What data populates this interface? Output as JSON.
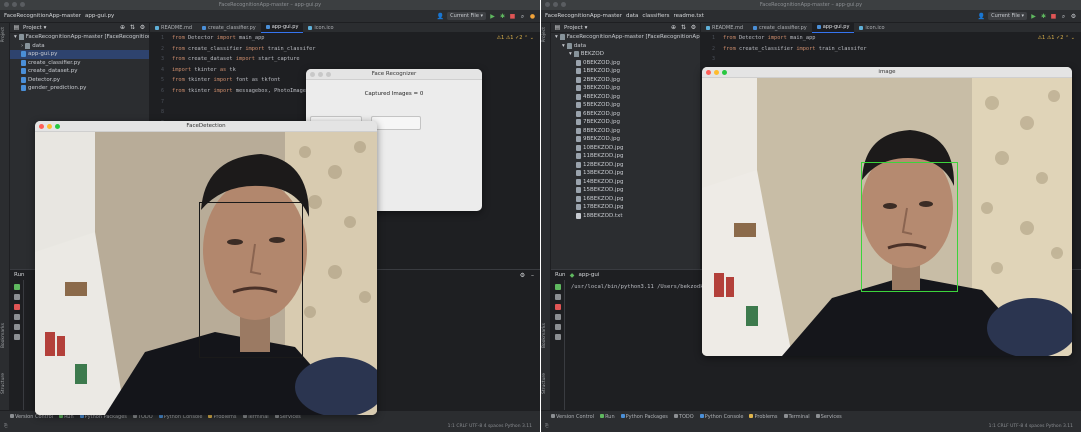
{
  "left": {
    "title": "FaceRecognitionApp-master – app-gui.py",
    "breadcrumb": [
      "FaceRecognitionApp-master",
      "app-gui.py"
    ],
    "current_file": "Current File ▾",
    "project_label": "Project ▾",
    "tree": [
      {
        "label": "FaceRecognitionApp-master [FaceRecognitionApp]",
        "kind": "folder",
        "indent": 0,
        "arrow": "▾"
      },
      {
        "label": "data",
        "kind": "folder",
        "indent": 1,
        "arrow": "›"
      },
      {
        "label": "app-gui.py",
        "kind": "py",
        "indent": 1,
        "selected": true
      },
      {
        "label": "create_classifier.py",
        "kind": "py",
        "indent": 1
      },
      {
        "label": "create_dataset.py",
        "kind": "py",
        "indent": 1
      },
      {
        "label": "Detector.py",
        "kind": "py",
        "indent": 1
      },
      {
        "label": "gender_prediction.py",
        "kind": "py",
        "indent": 1
      }
    ],
    "tabs": [
      {
        "label": "README.md",
        "type": "md",
        "active": false
      },
      {
        "label": "create_classifier.py",
        "type": "py",
        "active": false
      },
      {
        "label": "app-gui.py",
        "type": "py",
        "active": true
      },
      {
        "label": "icon.ico",
        "type": "md",
        "active": false
      }
    ],
    "code": [
      [
        "from",
        " Detector ",
        "import",
        " main_app"
      ],
      [
        "from",
        " create_classifier ",
        "import",
        " train_classifer"
      ],
      [
        "from",
        " create_dataset ",
        "import",
        " start_capture"
      ],
      [
        "import",
        " tkinter ",
        "as",
        " tk"
      ],
      [
        "from",
        " tkinter ",
        "import",
        " font as tkfont"
      ],
      [
        "from",
        " tkinter ",
        "import",
        " messagebox, PhotoImage"
      ]
    ],
    "inspections": "⚠1 ⚠1 ✓2 ⌃ ⌄",
    "run_label": "Run",
    "console": ""
  },
  "right": {
    "title": "FaceRecognitionApp-master – app-gui.py",
    "breadcrumb": [
      "FaceRecognitionApp-master",
      "data",
      "classifiers",
      "readme.txt"
    ],
    "current_file": "Current File ▾",
    "project_label": "Project ▾",
    "tree": [
      {
        "label": "FaceRecognitionApp-master [FaceRecognitionApp]",
        "kind": "folder",
        "indent": 0,
        "arrow": "▾"
      },
      {
        "label": "data",
        "kind": "folder",
        "indent": 1,
        "arrow": "▾"
      },
      {
        "label": "BEKZOD",
        "kind": "folder",
        "indent": 2,
        "arrow": "▾"
      },
      {
        "label": "0BEKZOD.jpg",
        "kind": "img",
        "indent": 3
      },
      {
        "label": "1BEKZOD.jpg",
        "kind": "img",
        "indent": 3
      },
      {
        "label": "2BEKZOD.jpg",
        "kind": "img",
        "indent": 3
      },
      {
        "label": "3BEKZOD.jpg",
        "kind": "img",
        "indent": 3
      },
      {
        "label": "4BEKZOD.jpg",
        "kind": "img",
        "indent": 3
      },
      {
        "label": "5BEKZOD.jpg",
        "kind": "img",
        "indent": 3
      },
      {
        "label": "6BEKZOD.jpg",
        "kind": "img",
        "indent": 3
      },
      {
        "label": "7BEKZOD.jpg",
        "kind": "img",
        "indent": 3
      },
      {
        "label": "8BEKZOD.jpg",
        "kind": "img",
        "indent": 3
      },
      {
        "label": "9BEKZOD.jpg",
        "kind": "img",
        "indent": 3
      },
      {
        "label": "10BEKZOD.jpg",
        "kind": "img",
        "indent": 3
      },
      {
        "label": "11BEKZOD.jpg",
        "kind": "img",
        "indent": 3
      },
      {
        "label": "12BEKZOD.jpg",
        "kind": "img",
        "indent": 3
      },
      {
        "label": "13BEKZOD.jpg",
        "kind": "img",
        "indent": 3
      },
      {
        "label": "14BEKZOD.jpg",
        "kind": "img",
        "indent": 3
      },
      {
        "label": "15BEKZOD.jpg",
        "kind": "img",
        "indent": 3
      },
      {
        "label": "16BEKZOD.jpg",
        "kind": "img",
        "indent": 3
      },
      {
        "label": "17BEKZOD.jpg",
        "kind": "img",
        "indent": 3
      },
      {
        "label": "18BEKZOD.txt",
        "kind": "txt",
        "indent": 3
      }
    ],
    "tabs": [
      {
        "label": "README.md",
        "type": "md",
        "active": false
      },
      {
        "label": "create_classifier.py",
        "type": "py",
        "active": false
      },
      {
        "label": "app-gui.py",
        "type": "py",
        "active": true
      },
      {
        "label": "icon.ico",
        "type": "md",
        "active": false
      }
    ],
    "code": [
      [
        "from",
        " Detector ",
        "import",
        " main_app"
      ],
      [
        "from",
        " create_classifier ",
        "import",
        " train_classifer"
      ]
    ],
    "inspections": "⚠1 ⚠1 ✓2 ⌃ ⌄",
    "run_label": "Run",
    "run_config": "app-gui",
    "console": "/usr/local/bin/python3.11 /Users/bekzodkhalilov"
  },
  "bottom_tools": [
    "Version Control",
    "Run",
    "Python Packages",
    "TODO",
    "Python Console",
    "Problems",
    "Terminal",
    "Services"
  ],
  "status_right": "1:1  CRLF  UTF-8  4 spaces  Python 3.11",
  "face_recognizer": {
    "title": "Face Recognizer",
    "captured_text": "Captured Images = 0"
  },
  "face_detection": {
    "title": "FaceDetection"
  },
  "image_window": {
    "title": "image"
  },
  "colors": {
    "detect_box": "#1a1a1a",
    "recognize_box": "#3cd43c",
    "selection": "#2e436e"
  }
}
